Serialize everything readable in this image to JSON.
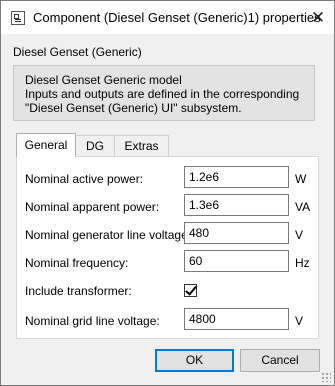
{
  "window": {
    "title": "Component (Diesel Genset (Generic)1) properties",
    "close_glyph": "✕"
  },
  "block_name": "Diesel Genset (Generic)",
  "description": [
    "Diesel Genset Generic model",
    "Inputs and outputs are defined in the corresponding",
    "\"Diesel Genset (Generic) UI\" subsystem."
  ],
  "tabs": [
    {
      "label": "General",
      "active": true
    },
    {
      "label": "DG",
      "active": false
    },
    {
      "label": "Extras",
      "active": false
    }
  ],
  "fields": {
    "active_power": {
      "label": "Nominal active power:",
      "value": "1.2e6",
      "unit": "W"
    },
    "apparent_power": {
      "label": "Nominal apparent power:",
      "value": "1.3e6",
      "unit": "VA"
    },
    "gen_line_voltage": {
      "label": "Nominal generator line voltage:",
      "value": "480",
      "unit": "V"
    },
    "frequency": {
      "label": "Nominal frequency:",
      "value": "60",
      "unit": "Hz"
    },
    "include_transformer": {
      "label": "Include transformer:",
      "checked": true
    },
    "grid_line_voltage": {
      "label": "Nominal grid line voltage:",
      "value": "4800",
      "unit": "V"
    }
  },
  "buttons": {
    "ok": "OK",
    "cancel": "Cancel"
  },
  "icons": {
    "window": "component-icon",
    "close": "close-icon",
    "check": "checkmark-icon",
    "grip": "resize-grip-icon"
  },
  "colors": {
    "default_button_border": "#0078d7",
    "panel_bg": "#ffffff",
    "window_bg": "#f0f0f0"
  }
}
